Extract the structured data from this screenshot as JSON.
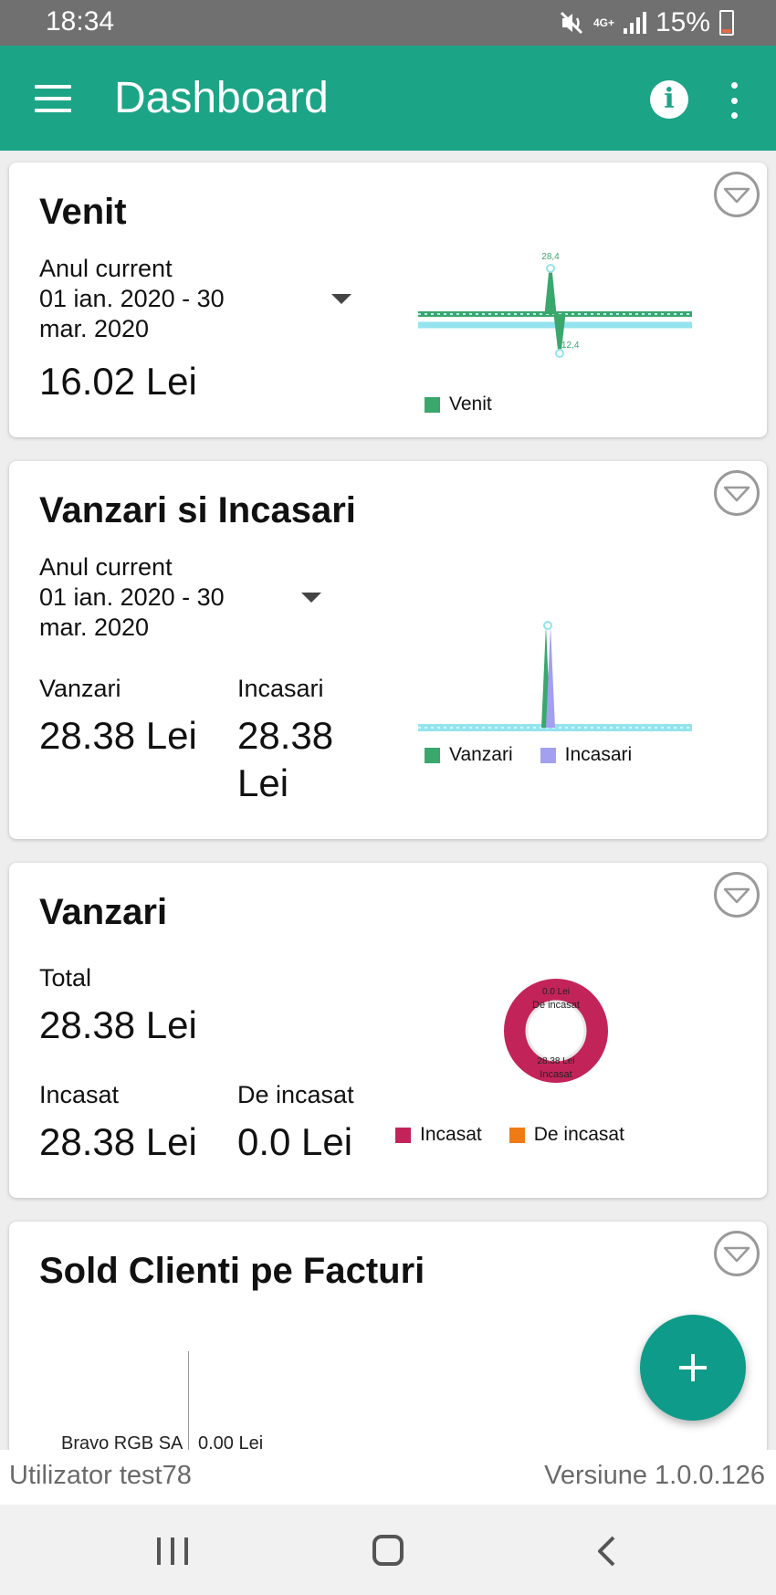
{
  "status_bar": {
    "time": "18:34",
    "network": "4G+",
    "battery": "15%"
  },
  "app_bar": {
    "title": "Dashboard"
  },
  "cards": {
    "venit": {
      "title": "Venit",
      "period_name": "Anul current",
      "period_line1": "01 ian. 2020 - 30",
      "period_line2": "mar. 2020",
      "amount": "16.02 Lei",
      "chart_peak_label": "28,4",
      "chart_dip_label": "-12,4",
      "legend": [
        {
          "label": "Venit",
          "color": "#3aa76d"
        }
      ]
    },
    "vanzari_incasari": {
      "title": "Vanzari si Incasari",
      "period_name": "Anul current",
      "period_line1": "01 ian. 2020 - 30",
      "period_line2": "mar. 2020",
      "vanzari_label": "Vanzari",
      "vanzari_value": "28.38 Lei",
      "incasari_label": "Incasari",
      "incasari_value_line1": "28.38",
      "incasari_value_line2": "Lei",
      "legend": [
        {
          "label": "Vanzari",
          "color": "#3aa76d"
        },
        {
          "label": "Incasari",
          "color": "#a3a0f0"
        }
      ]
    },
    "vanzari": {
      "title": "Vanzari",
      "total_label": "Total",
      "total_value": "28.38 Lei",
      "incasat_label": "Incasat",
      "incasat_value": "28.38 Lei",
      "de_incasat_label": "De incasat",
      "de_incasat_value": "0.0 Lei",
      "donut_top_value": "0.0 Lei",
      "donut_top_label": "De incasat",
      "donut_bottom_value": "28.38 Lei",
      "donut_bottom_label": "Incasat",
      "legend": [
        {
          "label": "Incasat",
          "color": "#c2245a"
        },
        {
          "label": "De incasat",
          "color": "#f07b14"
        }
      ]
    },
    "sold_clienti": {
      "title": "Sold Clienti pe Facturi",
      "client_name": "Bravo RGB SA",
      "client_value": "0.00 Lei"
    }
  },
  "footer": {
    "user": "Utilizator test78",
    "version": "Versiune 1.0.0.126"
  },
  "colors": {
    "primary": "#1ca486",
    "fab": "#0f9b89",
    "status_bar": "#707070"
  }
}
